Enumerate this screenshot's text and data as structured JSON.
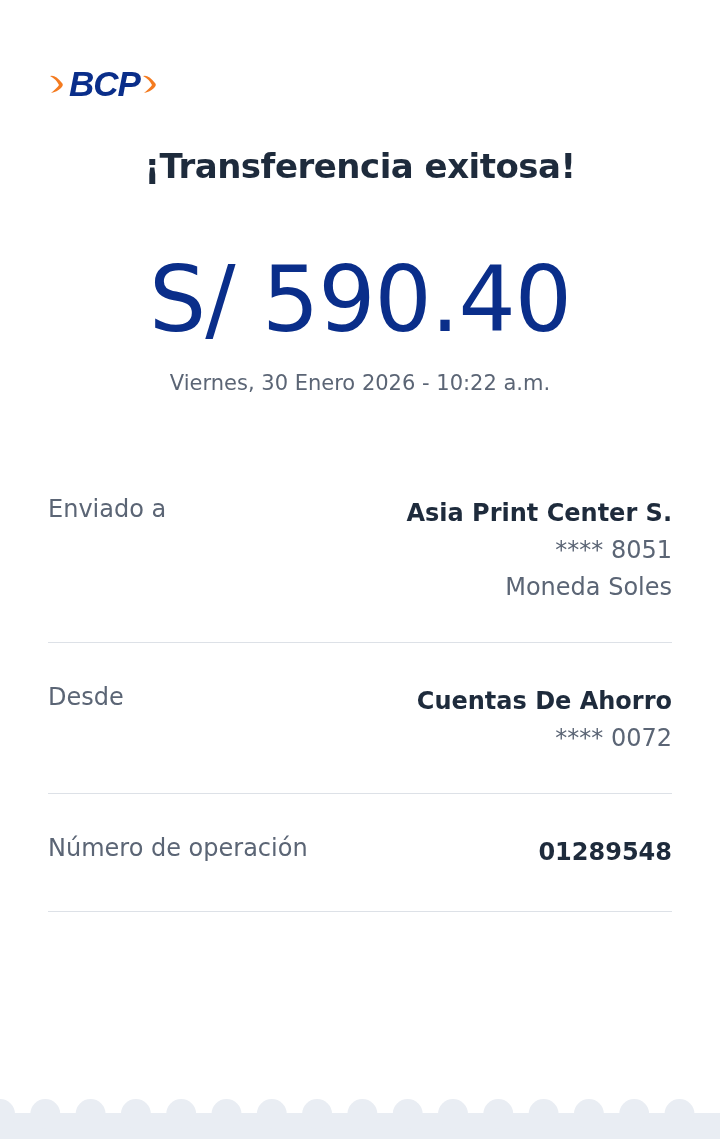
{
  "logo": {
    "text": "BCP"
  },
  "title": "¡Transferencia exitosa!",
  "amount": "S/ 590.40",
  "date": "Viernes, 30 Enero 2026 - 10:22 a.m.",
  "details": [
    {
      "label": "Enviado a",
      "lines": [
        "Asia Print Center S.",
        "**** 8051",
        "Moneda Soles"
      ]
    },
    {
      "label": "Desde",
      "lines": [
        "Cuentas De Ahorro",
        "**** 0072"
      ]
    },
    {
      "label": "Número de operación",
      "lines": [
        "01289548"
      ]
    }
  ]
}
